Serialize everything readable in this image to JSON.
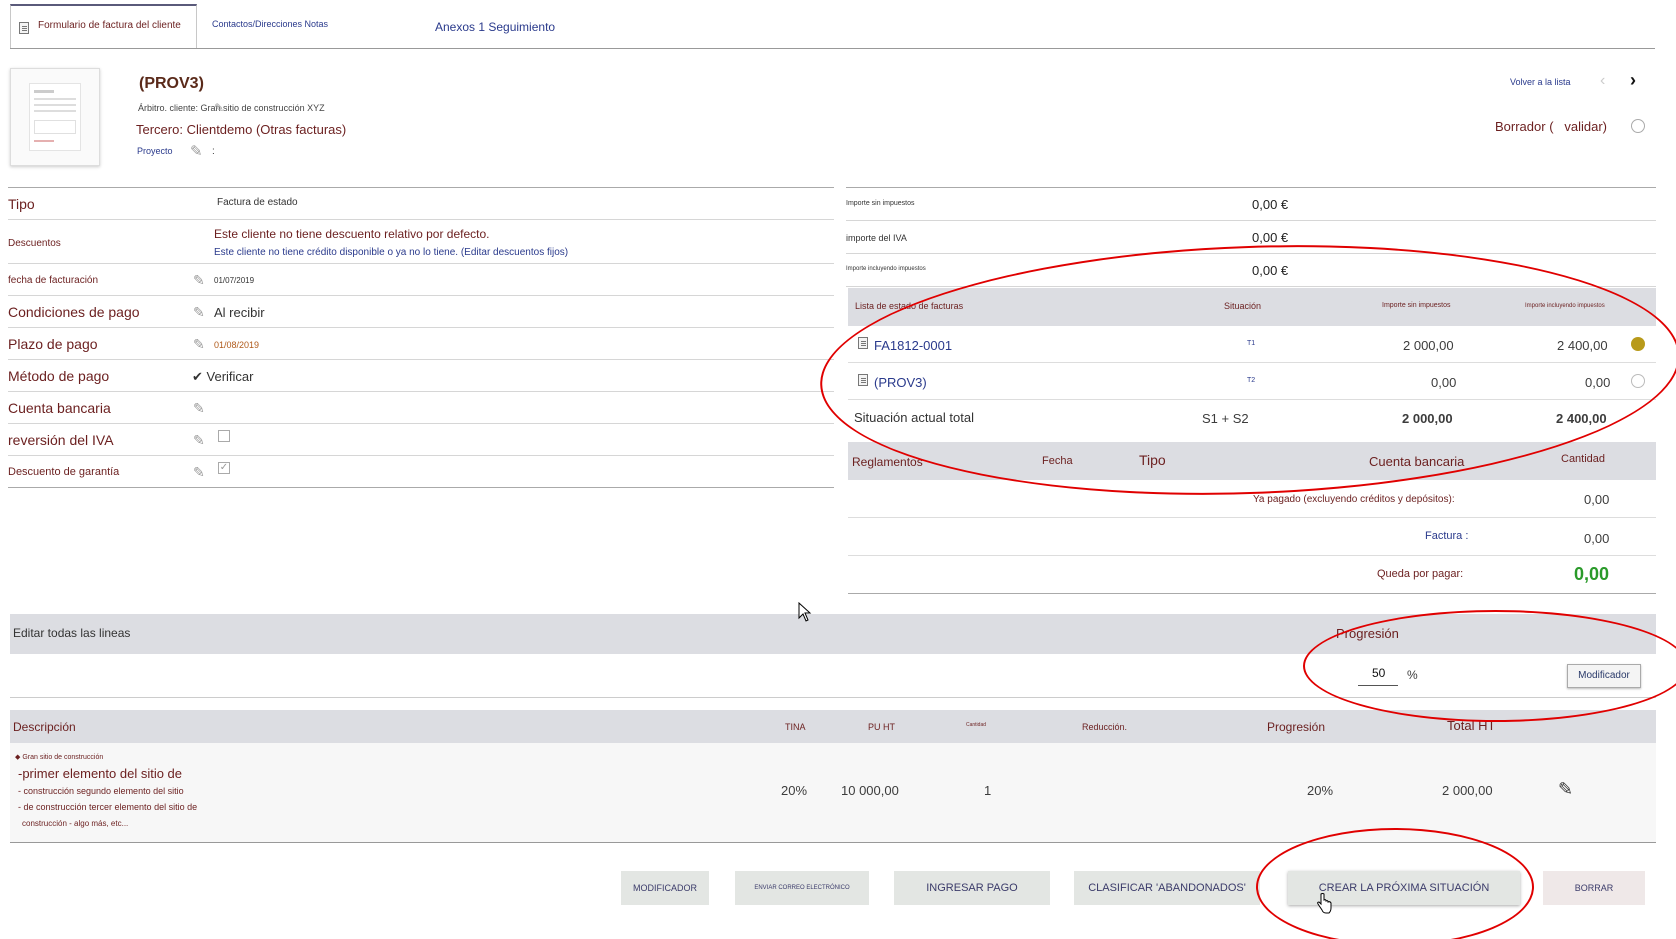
{
  "tabs": {
    "card": "Formulario de factura del cliente",
    "contacts": "Contactos/Direcciones Notas",
    "annexes": "Anexos 1 Seguimiento"
  },
  "header": {
    "ref": "(PROV3)",
    "customer_ref": "Árbitro. cliente: Gran sitio de construcción XYZ",
    "thirdparty": "Tercero: Clientdemo (Otras facturas)",
    "project_label": "Proyecto",
    "project_value": ":",
    "back_to_list": "Volver a la lista",
    "status": "Borrador (   validar)"
  },
  "fields": {
    "type_label": "Tipo",
    "type_value": "Factura de estado",
    "discounts_label": "Descuentos",
    "discount_line1": "Este cliente no tiene descuento relativo por defecto.",
    "discount_line2": "Este cliente no tiene crédito disponible o ya no lo tiene. (Editar descuentos fijos)",
    "invoice_date_label": "fecha de facturación",
    "invoice_date_value": "01/07/2019",
    "payment_terms_label": "Condiciones de pago",
    "payment_terms_value": "Al recibir",
    "due_date_label": "Plazo de pago",
    "due_date_value": "01/08/2019",
    "payment_method_label": "Método de pago",
    "payment_method_value": "✔ Verificar",
    "bank_account_label": "Cuenta bancaria",
    "vat_reversal_label": "reversión del IVA",
    "retained_warranty_label": "Descuento de garantía"
  },
  "totals": {
    "ht_label": "Importe sin impuestos",
    "ht_value": "0,00 €",
    "vat_label": "importe del IVA",
    "vat_value": "0,00 €",
    "ttc_label": "Importe incluyendo impuestos",
    "ttc_value": "0,00 €"
  },
  "situations": {
    "headers": {
      "list": "Lista de estado de facturas",
      "situation": "Situación",
      "ht": "Importe sin impuestos",
      "ttc": "Importe incluyendo impuestos"
    },
    "rows": [
      {
        "ref": "FA1812-0001",
        "situation": "T1",
        "ht": "2 000,00",
        "ttc": "2 400,00"
      },
      {
        "ref": "(PROV3)",
        "situation": "T2",
        "ht": "0,00",
        "ttc": "0,00"
      }
    ],
    "total_label": "Situación actual total",
    "total_situation": "S1 + S2",
    "total_ht": "2 000,00",
    "total_ttc": "2 400,00"
  },
  "payments": {
    "headers": {
      "payments": "Reglamentos",
      "date": "Fecha",
      "type": "Tipo",
      "bank": "Cuenta bancaria",
      "amount": "Cantidad"
    },
    "already_paid_label": "Ya pagado (excluyendo créditos y depósitos):",
    "already_paid_value": "0,00",
    "invoice_label": "Factura :",
    "invoice_value": "0,00",
    "remaining_label": "Queda por pagar:",
    "remaining_value": "0,00"
  },
  "edit_all": {
    "label": "Editar todas las lineas",
    "progress_label": "Progresión",
    "progress_value": "50",
    "percent": "%",
    "modify_button": "Modificador"
  },
  "lines": {
    "headers": {
      "description": "Descripción",
      "vat": "TINA",
      "pu_ht": "PU HT",
      "qty": "Cantidad",
      "reduction": "Reducción.",
      "progress": "Progresión",
      "total_ht": "Total HT"
    },
    "rows": [
      {
        "product": "◆ Gran sitio de construcción",
        "desc_main": "-primer elemento del sitio de",
        "desc_2": "- construcción segundo elemento del sitio",
        "desc_3": "- de construcción tercer elemento del sitio de",
        "desc_4": "construcción - algo más, etc...",
        "vat": "20%",
        "pu_ht": "10 000,00",
        "qty": "1",
        "progress": "20%",
        "total_ht": "2 000,00"
      }
    ]
  },
  "actions": {
    "modify": "MODIFICADOR",
    "send_email": "ENVIAR CORREO ELECTRÓNICO",
    "enter_payment": "INGRESAR PAGO",
    "classify_abandoned": "CLASIFICAR 'ABANDONADOS'",
    "create_next_situation": "CREAR LA PRÓXIMA SITUACIÓN",
    "delete": "BORRAR"
  },
  "colors": {
    "accent_maroon": "#6b1f1f",
    "link_navy": "#2a3a8c",
    "annotation_red": "#e00000",
    "paid_green": "#2a9a2a",
    "status_gold": "#b89a1a"
  }
}
